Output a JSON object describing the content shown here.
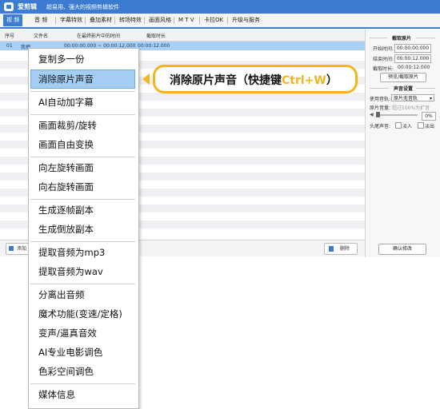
{
  "app": {
    "name": "爱剪辑",
    "slogan": "超易用、强大的视频剪辑软件"
  },
  "tabs": [
    "视 频",
    "音 频",
    "字幕特效",
    "叠加素材",
    "转场特效",
    "画面风格",
    "M T V",
    "卡拉OK",
    "升级与服务"
  ],
  "table": {
    "headers": [
      "序号",
      "文件名",
      "在最终影片中的时间",
      "截取时长"
    ],
    "row": {
      "index": "01",
      "name": "我把",
      "time": "00:00:00.000 ~ 00:00:12.000",
      "duration": "00:00:12.000"
    }
  },
  "bottom": {
    "add_label": "添加",
    "delete_label": "删除"
  },
  "right_panel": {
    "clip_title": "截取原片",
    "start_label": "开始时间:",
    "start_value": "00:00:00.000",
    "end_label": "结束时间:",
    "end_value": "00:00:12.000",
    "duration_label": "截取时长:",
    "duration_value": "00:00:12.000",
    "preview_button": "预览/截取原片",
    "audio_title": "声音设置",
    "track_label": "使用音轨:",
    "track_value": "原片无音轨",
    "volume_label": "原片音量:",
    "volume_hint": "超过100%为扩音",
    "volume_value": "0%",
    "fade_label": "头尾声音:",
    "fade_in": "淡入",
    "fade_out": "淡出",
    "confirm_button": "确认修改"
  },
  "menu": {
    "items": [
      "复制多一份",
      "消除原片声音",
      "AI自动加字幕",
      "画面裁剪/旋转",
      "画面自由变换",
      "向左旋转画面",
      "向右旋转画面",
      "生成逐帧副本",
      "生成倒放副本",
      "提取音频为mp3",
      "提取音频为wav",
      "分离出音频",
      "魔术功能(变速/定格)",
      "变声/逼真音效",
      "AI专业电影调色",
      "色彩空间调色",
      "媒体信息"
    ],
    "selected_index": 1
  },
  "callout": {
    "text": "消除原片声音（快捷键",
    "shortcut": "Ctrl+W",
    "close": "）"
  },
  "colors": {
    "accent": "#3b7bd2",
    "callout_border": "#f2b51e",
    "menu_highlight": "#a4cdf3"
  }
}
